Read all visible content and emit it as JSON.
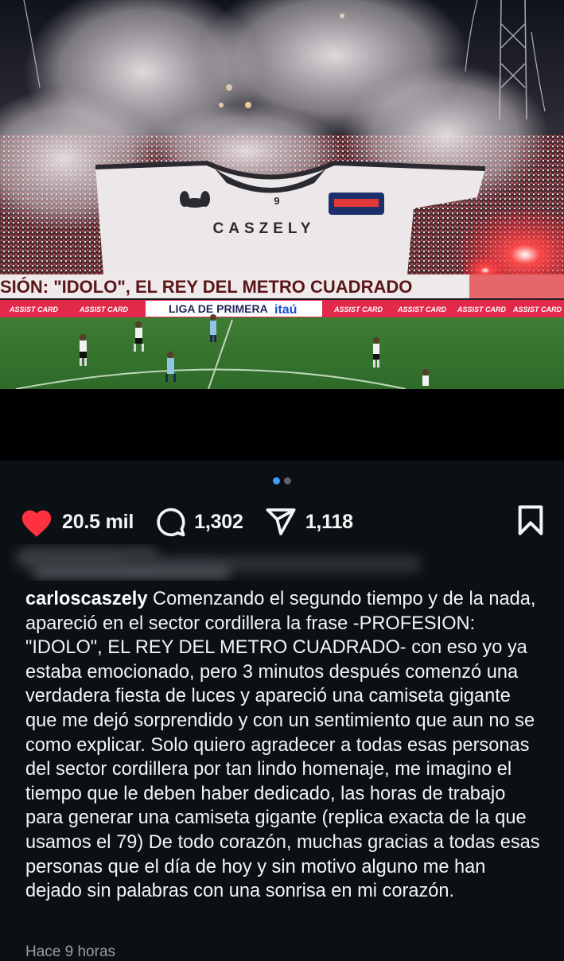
{
  "post": {
    "image_alt": "Estadio con humo de bengalas y una camiseta gigante con el nombre del jugador",
    "banner_text": "SIÓN: \"IDOLO\", EL REY DEL METRO CUADRADO",
    "jersey_text": "CASZELY",
    "jersey_number": "9",
    "league_board": "LIGA DE PRIMERA",
    "league_sponsor": "itaú",
    "ad_boards": [
      "ASSIST CARD",
      "ASSIST CARD",
      "ASSIST CARD",
      "ASSIST CARD",
      "ASSIST CARD",
      "ASSIST CARD"
    ],
    "carousel": {
      "count": 2,
      "active": 1
    }
  },
  "actions": {
    "likes": "20.5 mil",
    "comments": "1,302",
    "shares": "1,118"
  },
  "colors": {
    "background": "#0b1014",
    "like_red": "#ff3040",
    "dot_active": "#3d9df5",
    "dot_inactive": "#5e6165"
  },
  "icons": {
    "like": "heart-icon",
    "comment": "comment-bubble-icon",
    "share": "paper-plane-icon",
    "save": "bookmark-icon"
  },
  "caption": {
    "username": "carloscaszely",
    "text": " Comenzando el segundo tiempo y de la nada, apareció en el sector cordillera la frase -PROFESION: \"IDOLO\", EL REY DEL METRO CUADRADO-  con eso yo ya estaba emocionado, pero 3 minutos después comenzó una verdadera fiesta de luces y apareció una camiseta gigante que me dejó sorprendido y con un sentimiento que aun no se como explicar. Solo quiero agradecer a todas esas personas del sector cordillera por tan lindo homenaje, me imagino el tiempo que le deben haber dedicado, las horas de trabajo para generar una camiseta gigante (replica exacta de la que usamos el 79) De todo corazón, muchas gracias a todas esas personas que el día de hoy y sin motivo alguno me han dejado sin palabras con una sonrisa en mi corazón."
  },
  "timestamp": "Hace 9 horas"
}
